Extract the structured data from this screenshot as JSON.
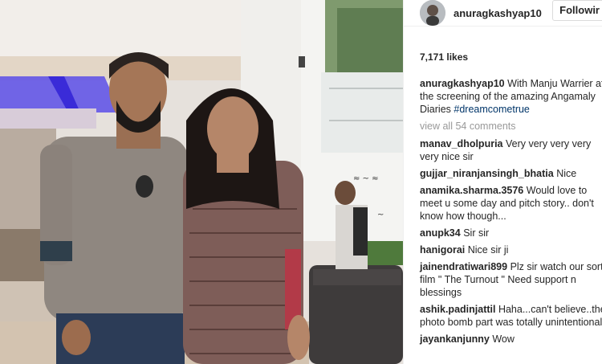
{
  "post": {
    "username": "anuragkashyap10",
    "follow_label": "Followir",
    "likes": "7,171 likes",
    "caption_user": "anuragkashyap10",
    "caption_text": "With Manju Warrier at the screening of the amazing Angamaly Diaries",
    "caption_hashtag": "#dreamcometrue",
    "view_all": "view all 54 comments"
  },
  "comments": [
    {
      "user": "manav_dholpuria",
      "text": "Very very very very very nice sir"
    },
    {
      "user": "gujjar_niranjansingh_bhatia",
      "text": "Nice"
    },
    {
      "user": "anamika.sharma.3576",
      "text": "Would love to meet u some day and pitch story.. don't know how though..."
    },
    {
      "user": "anupk34",
      "text": "Sir sir"
    },
    {
      "user": "hanigorai",
      "text": "Nice sir ji"
    },
    {
      "user": "jainendratiwari899",
      "text": "Plz sir watch our sort film \" The Turnout \" Need support n blessings"
    },
    {
      "user": "ashik.padinjattil",
      "text": "Haha...can't believe..the photo bomb part was totally unintentional"
    },
    {
      "user": "jayankanjunny",
      "text": "Wow"
    }
  ],
  "colors": {
    "text": "#262626",
    "muted": "#999999",
    "hashtag": "#003569",
    "ceiling_light": "#4b3de0"
  }
}
